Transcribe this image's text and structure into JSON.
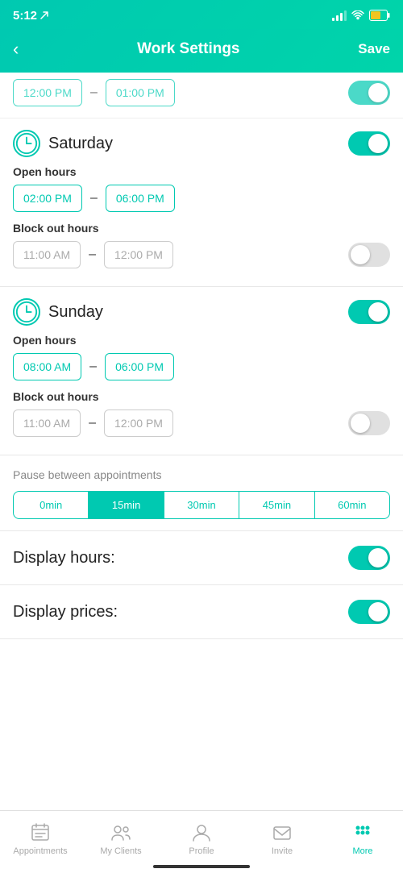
{
  "statusBar": {
    "time": "5:12",
    "navigationArrow": "↗"
  },
  "header": {
    "backLabel": "‹",
    "title": "Work Settings",
    "saveLabel": "Save"
  },
  "partialSection": {
    "time1": "12:00 PM",
    "time2": "01:00 PM"
  },
  "saturday": {
    "dayName": "Saturday",
    "toggleOn": true,
    "openHours": {
      "label": "Open hours",
      "start": "02:00 PM",
      "end": "06:00 PM"
    },
    "blockOutHours": {
      "label": "Block out hours",
      "start": "11:00 AM",
      "end": "12:00 PM",
      "toggleOn": false
    }
  },
  "sunday": {
    "dayName": "Sunday",
    "toggleOn": true,
    "openHours": {
      "label": "Open hours",
      "start": "08:00 AM",
      "end": "06:00 PM"
    },
    "blockOutHours": {
      "label": "Block out hours",
      "start": "11:00 AM",
      "end": "12:00 PM",
      "toggleOn": false
    }
  },
  "pauseSection": {
    "label": "Pause between appointments",
    "options": [
      "0min",
      "15min",
      "30min",
      "45min",
      "60min"
    ],
    "activeIndex": 1
  },
  "displayHours": {
    "label": "Display hours:",
    "toggleOn": true
  },
  "displayPrices": {
    "label": "Display prices:",
    "toggleOn": true
  },
  "bottomNav": {
    "items": [
      {
        "id": "appointments",
        "label": "Appointments",
        "active": false
      },
      {
        "id": "my-clients",
        "label": "My Clients",
        "active": false
      },
      {
        "id": "profile",
        "label": "Profile",
        "active": false
      },
      {
        "id": "invite",
        "label": "Invite",
        "active": false
      },
      {
        "id": "more",
        "label": "More",
        "active": true
      }
    ]
  }
}
